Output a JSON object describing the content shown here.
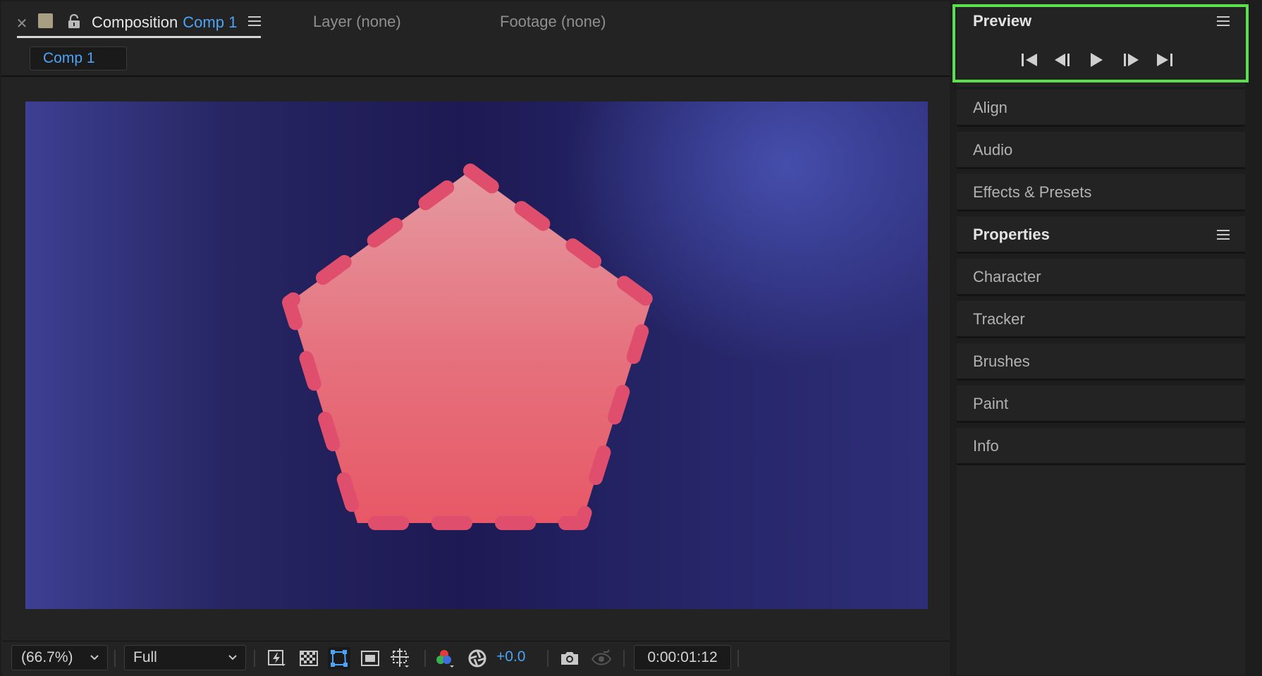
{
  "composition_panel": {
    "tab_prefix": "Composition",
    "tab_name": "Comp 1",
    "layer_tab": "Layer (none)",
    "footage_tab": "Footage (none)",
    "breadcrumb": "Comp 1"
  },
  "toolbar": {
    "zoom": "(66.7%)",
    "resolution": "Full",
    "exposure": "+0.0",
    "timecode": "0:00:01:12"
  },
  "panels": {
    "preview": "Preview",
    "align": "Align",
    "audio": "Audio",
    "effects_presets": "Effects & Presets",
    "properties": "Properties",
    "character": "Character",
    "tracker": "Tracker",
    "brushes": "Brushes",
    "paint": "Paint",
    "info": "Info"
  },
  "colors": {
    "accent_blue": "#4da3f5",
    "highlight_green": "#59e04a",
    "shape_fill_top": "#e38a93",
    "shape_fill_bottom": "#e85a68",
    "stroke_dash": "#df4e6c",
    "bg_navy": "#1d1953"
  },
  "icons": [
    "close-icon",
    "lock-icon",
    "menu-icon",
    "chevron-down-icon",
    "fast-preview-icon",
    "transparency-grid-icon",
    "region-of-interest-icon",
    "mask-visibility-icon",
    "grid-guides-icon",
    "color-channels-icon",
    "exposure-icon",
    "camera-snapshot-icon",
    "show-snapshot-icon",
    "skip-to-start-icon",
    "step-back-icon",
    "play-icon",
    "step-forward-icon",
    "skip-to-end-icon"
  ]
}
